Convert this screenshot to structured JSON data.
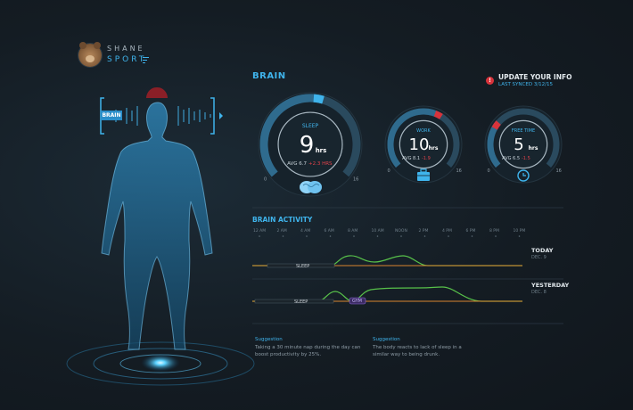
{
  "brand": {
    "line1": "SHANE",
    "line2": "SPORT",
    "menu_icon": "menu-icon",
    "avatar_icon": "bear-icon"
  },
  "figure": {
    "tag": "BRAIN"
  },
  "header": {
    "title": "BRAIN",
    "update_title": "UPDATE YOUR INFO",
    "update_sub": "LAST SYNCED 3/12/15"
  },
  "gauges": [
    {
      "label": "SLEEP",
      "value": "9",
      "unit": "hrs",
      "avg": "AVG 6.7",
      "delta": "+2.3 HRS",
      "min": "0",
      "max": "16",
      "fraction": 0.5625,
      "accent": "#3fb4ec",
      "icon": "brain-icon"
    },
    {
      "label": "WORK",
      "value": "10",
      "unit": "hrs",
      "avg": "AVG 8.1",
      "delta": "-1.9",
      "min": "0",
      "max": "16",
      "fraction": 0.625,
      "accent": "#d8333b",
      "icon": "briefcase-icon"
    },
    {
      "label": "FREE TIME",
      "value": "5",
      "unit": "hrs",
      "avg": "AVG 6.5",
      "delta": "-1.5",
      "min": "0",
      "max": "16",
      "fraction": 0.3125,
      "accent": "#d8333b",
      "icon": "clock-icon"
    }
  ],
  "activity": {
    "title": "BRAIN ACTIVITY",
    "ticks": [
      "12 AM",
      "2 AM",
      "4 AM",
      "6 AM",
      "8 AM",
      "10 AM",
      "NOON",
      "2 PM",
      "4 PM",
      "6 PM",
      "8 PM",
      "10 PM"
    ],
    "rows": [
      {
        "day": "TODAY",
        "date": "DEC. 9",
        "tags": [
          "SLEEP"
        ]
      },
      {
        "day": "YESTERDAY",
        "date": "DEC. 8",
        "tags": [
          "SLEEP",
          "GYM"
        ]
      }
    ]
  },
  "suggestions": [
    {
      "title": "Suggestion",
      "text": "Taking a 30 minute nap during the day can boost productivity by 25%."
    },
    {
      "title": "Suggestion",
      "text": "The body reacts to lack of sleep in a similar way to being drunk."
    }
  ],
  "colors": {
    "accent": "#3fb4ec",
    "alert": "#d8333b",
    "activity_green": "#58c24a",
    "activity_orange": "#d9852f"
  }
}
